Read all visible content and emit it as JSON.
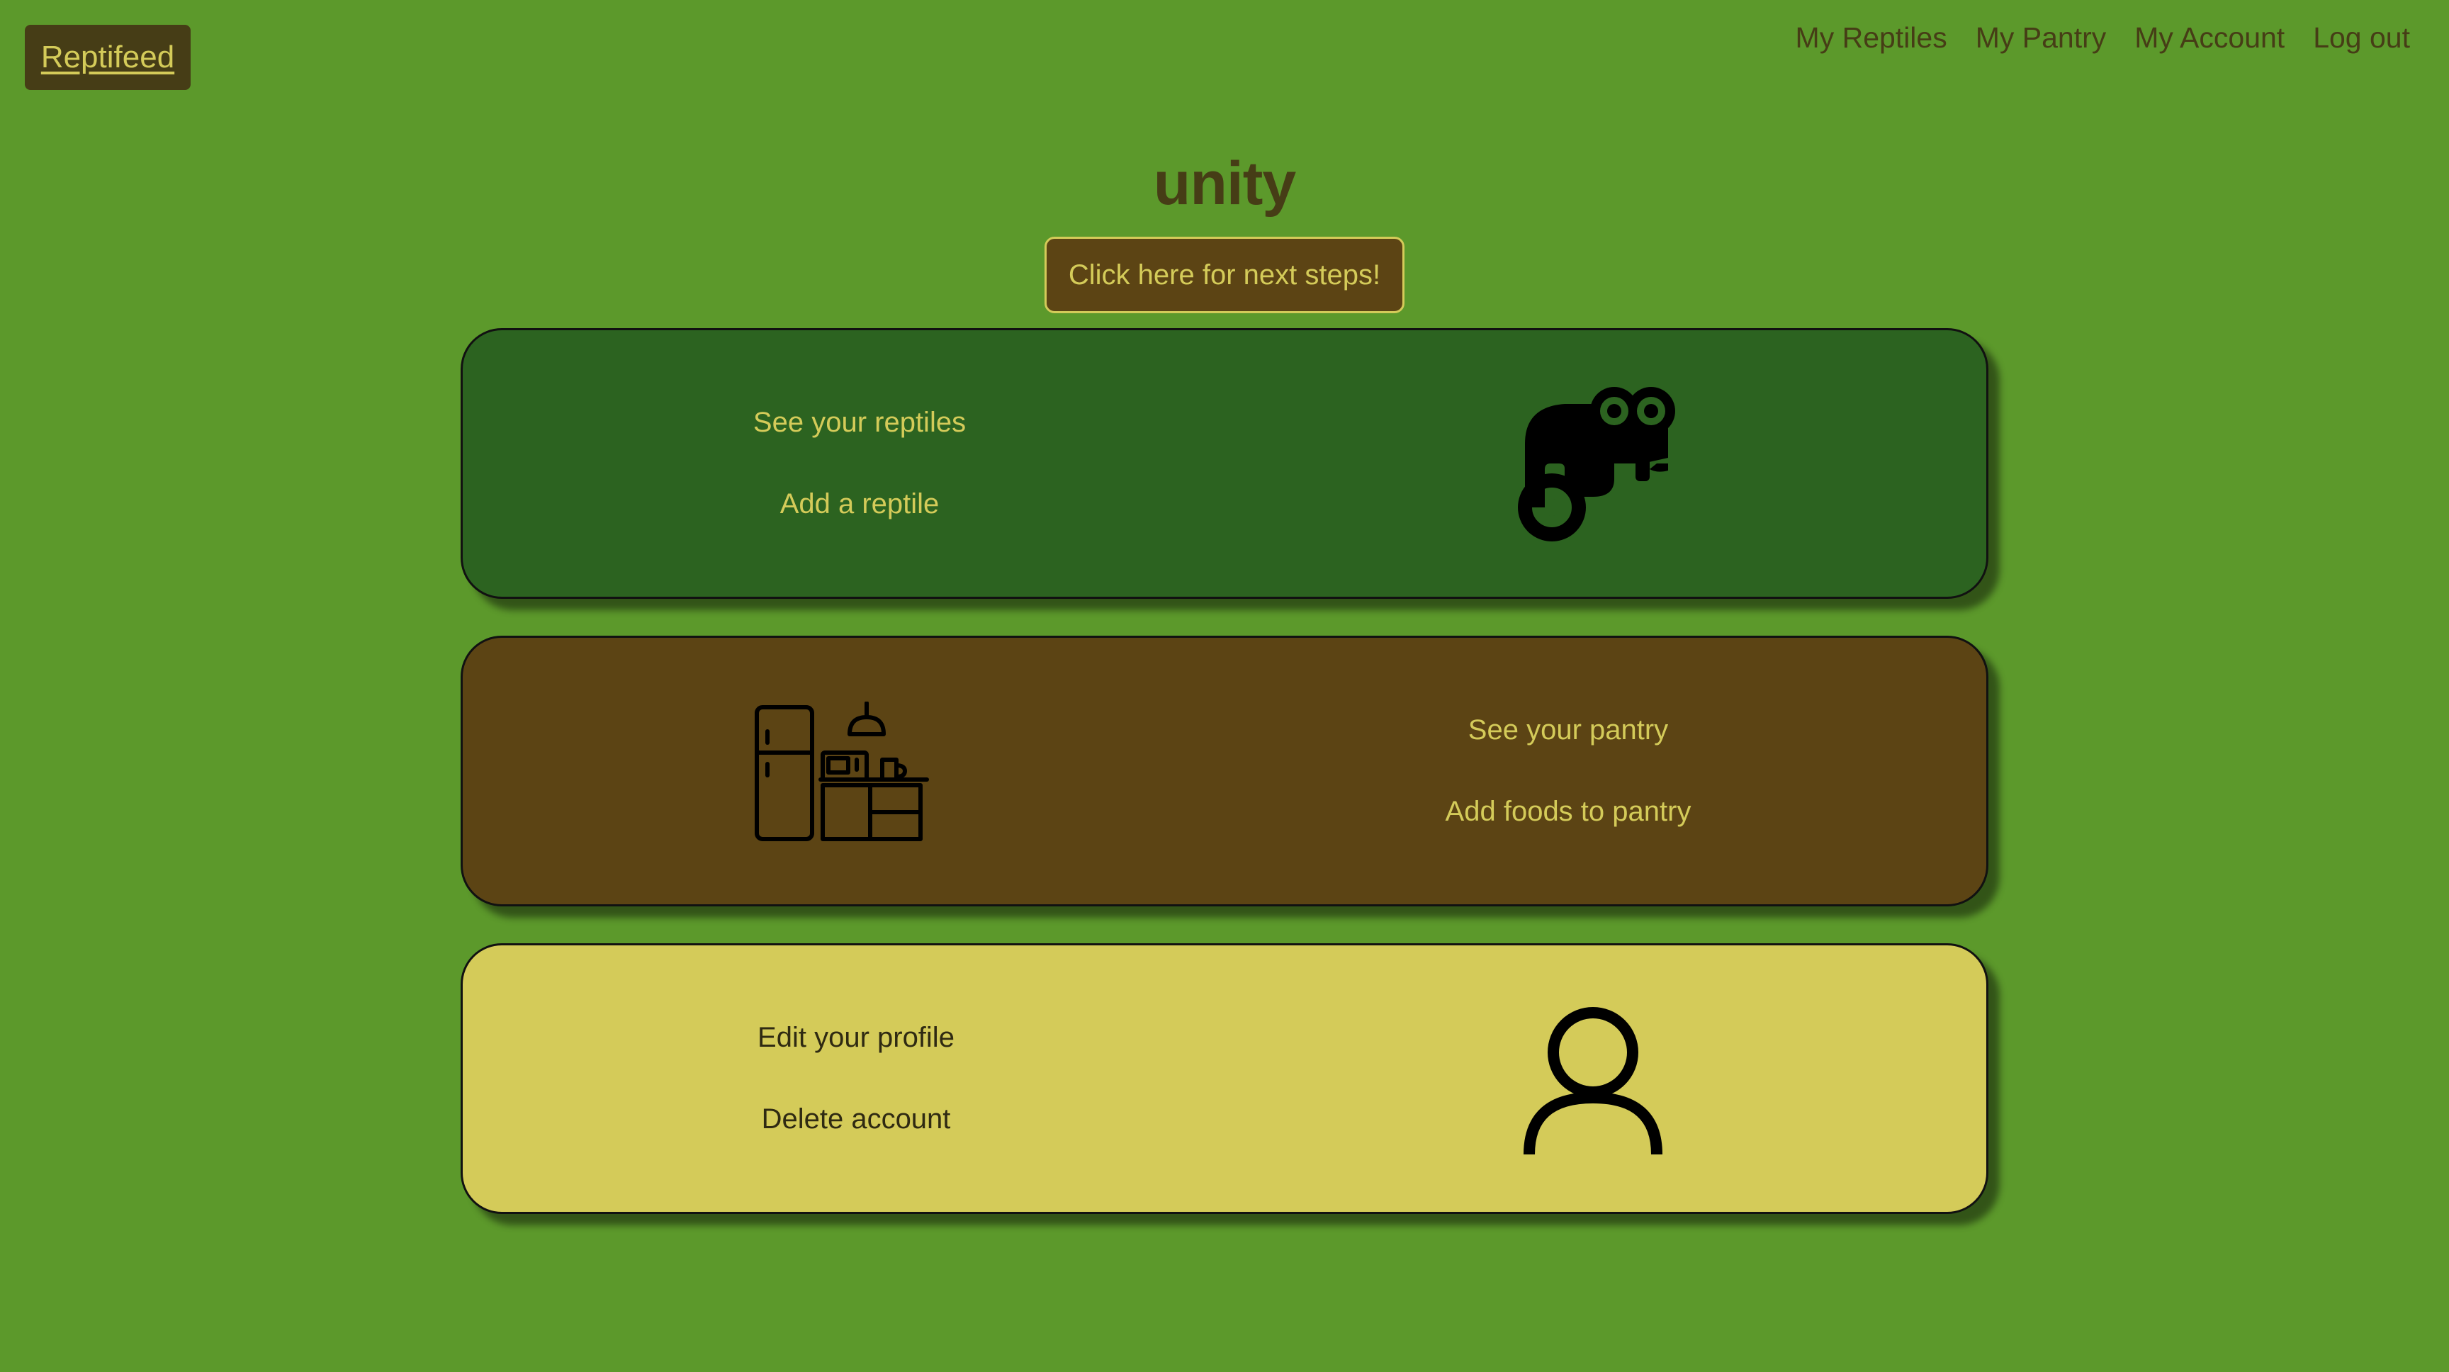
{
  "brand": {
    "label": "Reptifeed"
  },
  "nav": {
    "items": [
      "My Reptiles",
      "My Pantry",
      "My Account",
      "Log out"
    ]
  },
  "page": {
    "title": "unity",
    "next_steps_label": "Click here for next steps!"
  },
  "cards": {
    "reptiles": {
      "links": [
        "See your reptiles",
        "Add a reptile"
      ],
      "icon": "chameleon-icon"
    },
    "pantry": {
      "links": [
        "See your pantry",
        "Add foods to pantry"
      ],
      "icon": "kitchen-icon"
    },
    "account": {
      "links": [
        "Edit your profile",
        "Delete account"
      ],
      "icon": "user-icon"
    }
  },
  "colors": {
    "background": "#5c992b",
    "dark_brown": "#463d16",
    "accent_yellow": "#d4cb59",
    "reptile_card": "#2c6320",
    "pantry_card": "#5c4414",
    "account_card": "#d4cb59"
  }
}
